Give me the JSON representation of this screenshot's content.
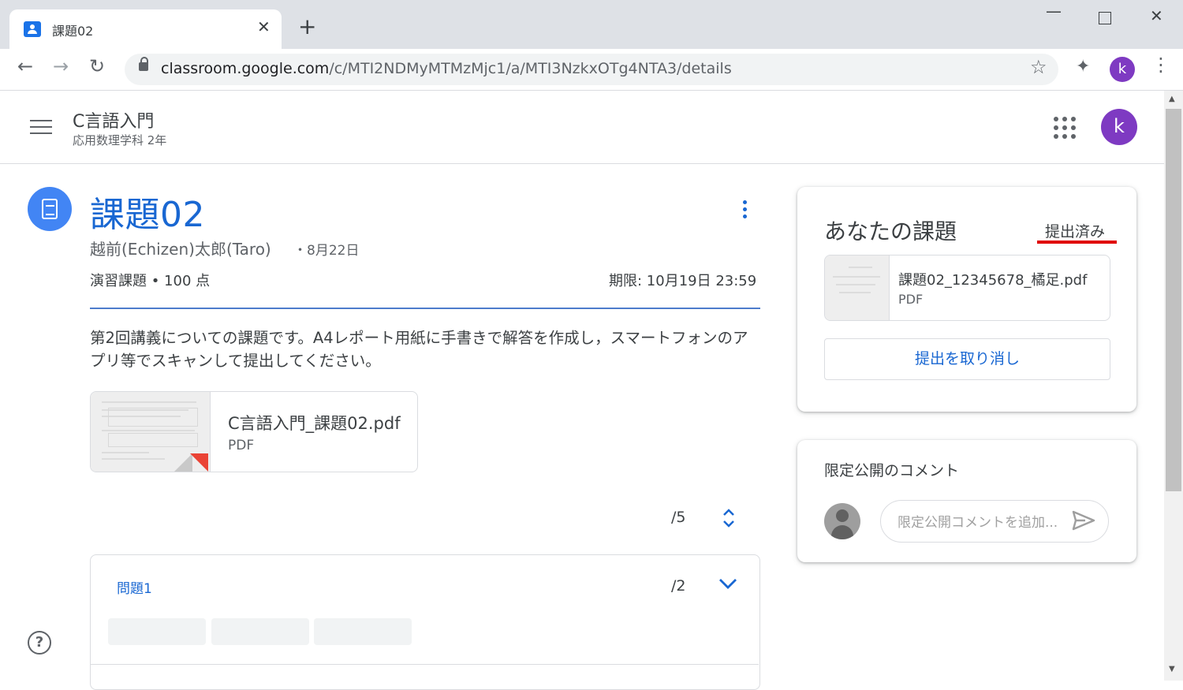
{
  "browser": {
    "tab_title": "課題02",
    "tab_close": "✕",
    "new_tab": "+",
    "url_host": "classroom.google.com",
    "url_path": "/c/MTI2NDMyMTMzMjc1/a/MTI3NzkxOTg4NTA3/details",
    "profile_initial": "k"
  },
  "header": {
    "class_name": "C言語入門",
    "class_section": "応用数理学科 2年",
    "avatar_initial": "k"
  },
  "assignment": {
    "title": "課題02",
    "author": "越前(Echizen)太郎(Taro)",
    "posted_date": "・8月22日",
    "type_points": "演習課題 • 100 点",
    "due": "期限: 10月19日 23:59",
    "description": "第2回講義についての課題です。A4レポート用紙に手書きで解答を作成し，スマートフォンのアプリ等でスキャンして提出してください。",
    "attachment": {
      "name": "C言語入門_課題02.pdf",
      "type": "PDF"
    },
    "total_score": "/5",
    "question": {
      "title": "問題1",
      "score": "/2"
    }
  },
  "your_work": {
    "title": "あなたの課題",
    "status": "提出済み",
    "status_underline_color": "#e00000",
    "file": {
      "name": "課題02_12345678_橘足.pdf",
      "type": "PDF"
    },
    "unsubmit_label": "提出を取り消し"
  },
  "private_comments": {
    "title": "限定公開のコメント",
    "placeholder": "限定公開コメントを追加..."
  },
  "help_glyph": "?"
}
